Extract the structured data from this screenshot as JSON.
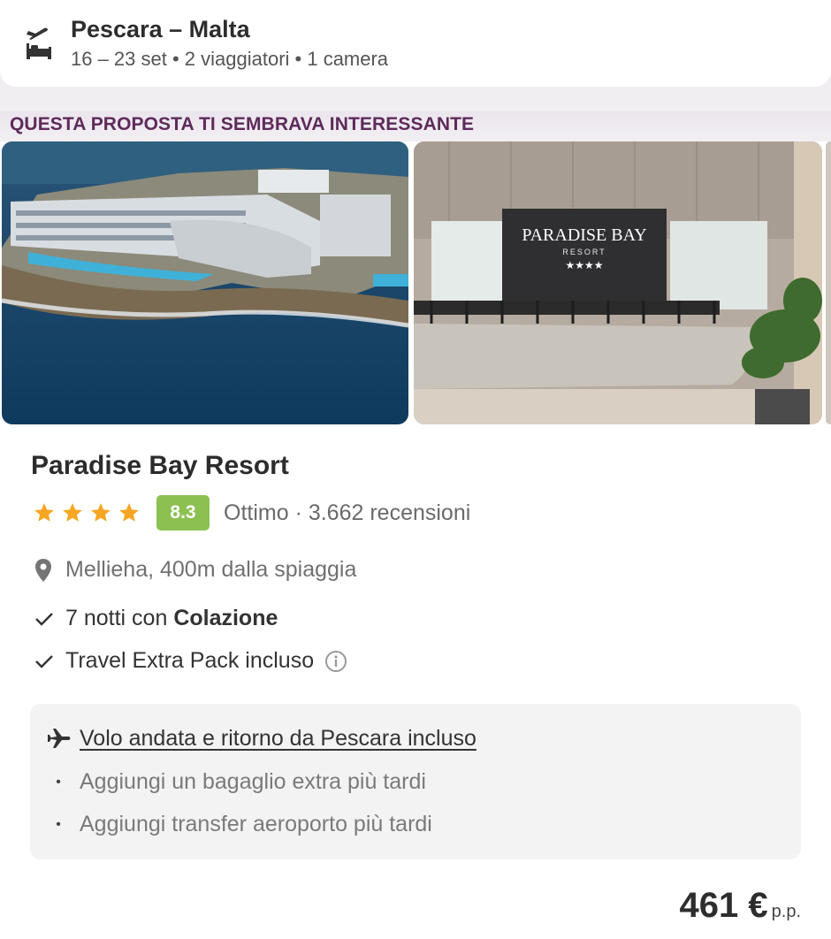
{
  "search": {
    "icon": "flight-hotel-icon",
    "title": "Pescara – Malta",
    "details": "16 – 23 set • 2 viaggiatori • 1 camera"
  },
  "section": {
    "title": "QUESTA PROPOSTA TI SEMBRAVA INTERESSANTE"
  },
  "photos": [
    {
      "name": "hotel-aerial-photo"
    },
    {
      "name": "hotel-reception-photo",
      "sign_text": "PARADISE BAY",
      "sign_sub": "RESORT",
      "sign_stars": "★★★★"
    }
  ],
  "hotel": {
    "name": "Paradise Bay Resort",
    "stars": 4,
    "score": "8.3",
    "rating_text": "Ottimo · 3.662 recensioni",
    "location": "Mellieha, 400m dalla spiaggia",
    "feature_1_prefix": "7 notti con ",
    "feature_1_bold": "Colazione",
    "feature_2": "Travel Extra Pack incluso"
  },
  "flight": {
    "title": "Volo andata e ritorno da Pescara incluso",
    "extras": [
      "Aggiungi un bagaglio extra più tardi",
      "Aggiungi transfer aeroporto più tardi"
    ],
    "bullet": "•"
  },
  "price": {
    "value": "461 €",
    "unit": "p.p."
  },
  "colors": {
    "accent": "#5e2a5b",
    "score_badge": "#8cc152",
    "star": "#f5a623"
  }
}
